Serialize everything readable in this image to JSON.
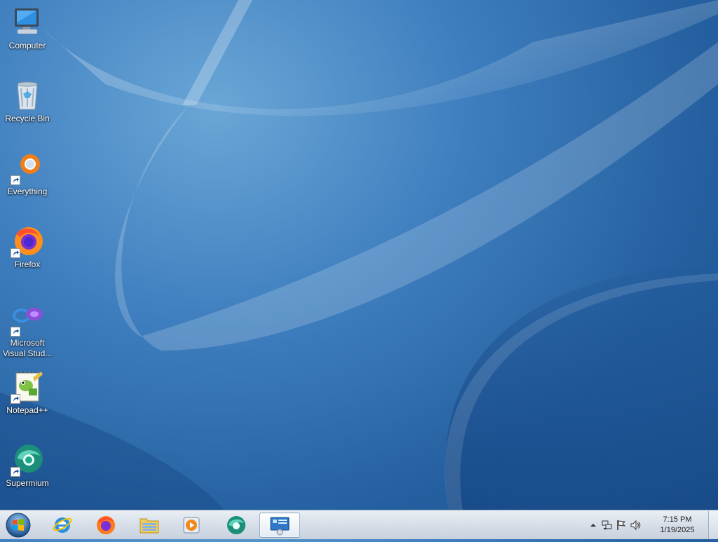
{
  "desktop": {
    "icons": [
      {
        "label": "Computer"
      },
      {
        "label": "Recycle Bin"
      },
      {
        "label": "Everything"
      },
      {
        "label": "Firefox"
      },
      {
        "label": "Microsoft Visual Stud..."
      },
      {
        "label": "Notepad++"
      },
      {
        "label": "Supermium"
      }
    ]
  },
  "taskbar": {
    "start": {
      "icon": "windows-logo-icon"
    },
    "pinned": [
      {
        "name": "Internet Explorer",
        "icon": "internet-explorer-icon"
      },
      {
        "name": "Firefox",
        "icon": "firefox-icon"
      },
      {
        "name": "Windows Explorer",
        "icon": "folder-icon"
      },
      {
        "name": "Windows Media Player",
        "icon": "media-player-icon"
      },
      {
        "name": "Supermium",
        "icon": "supermium-icon"
      },
      {
        "name": "Remote Desktop",
        "icon": "remote-desktop-icon"
      }
    ],
    "tray": {
      "time": "7:15 PM",
      "date": "1/19/2025"
    }
  },
  "colors": {
    "wallpaper": "#2e6aa8",
    "taskbar": "#d6dee8"
  }
}
